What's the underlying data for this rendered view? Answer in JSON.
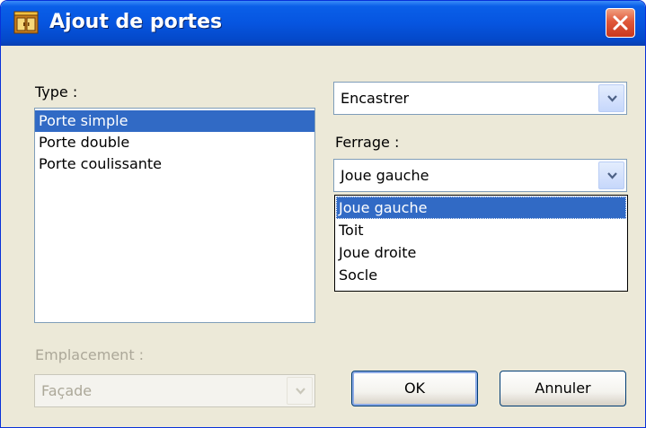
{
  "window": {
    "title": "Ajout de portes",
    "title_icon": "cabinet-icon",
    "close_icon": "close-icon"
  },
  "type_section": {
    "label": "Type :",
    "items": [
      "Porte simple",
      "Porte double",
      "Porte coulissante"
    ],
    "selected": "Porte simple"
  },
  "mount_combo": {
    "value": "Encastrer"
  },
  "ferrage": {
    "label": "Ferrage :",
    "value": "Joue gauche",
    "options": [
      "Joue gauche",
      "Toit",
      "Joue droite",
      "Socle"
    ],
    "highlighted": "Joue gauche"
  },
  "emplacement": {
    "label": "Emplacement :",
    "value": "Façade",
    "disabled": true
  },
  "buttons": {
    "ok_label": "OK",
    "cancel_label": "Annuler"
  },
  "colors": {
    "titlebar": "#0655e0",
    "selection": "#316ac5",
    "dialog_bg": "#ece9d8",
    "close_button": "#e0583a"
  }
}
